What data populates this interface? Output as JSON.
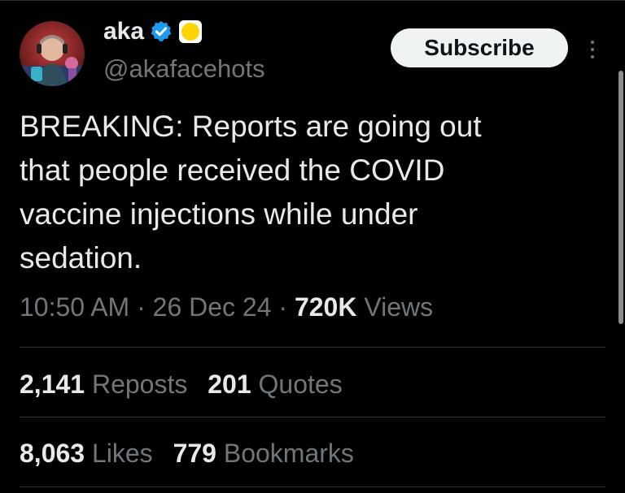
{
  "author": {
    "display_name": "aka",
    "handle": "@akafacehots",
    "verified_icon": "verified-badge-icon",
    "extra_badge_icon": "gold-circle-icon"
  },
  "actions": {
    "subscribe_label": "Subscribe",
    "more_icon": "more-vertical-icon"
  },
  "tweet": {
    "text_lines": [
      "BREAKING: Reports are going out",
      "that people received the COVID",
      "vaccine injections while under",
      "sedation."
    ],
    "time": "10:50 AM",
    "date": "26 Dec 24",
    "separator": "·",
    "views_count": "720K",
    "views_label": "Views"
  },
  "stats": {
    "reposts": {
      "count": "2,141",
      "label": "Reposts"
    },
    "quotes": {
      "count": "201",
      "label": "Quotes"
    },
    "likes": {
      "count": "8,063",
      "label": "Likes"
    },
    "bookmarks": {
      "count": "779",
      "label": "Bookmarks"
    }
  },
  "colors": {
    "background": "#000000",
    "text_primary": "#e7e9ea",
    "text_secondary": "#71767b",
    "verified_blue": "#1d9bf0",
    "badge_gold": "#ffd400"
  }
}
